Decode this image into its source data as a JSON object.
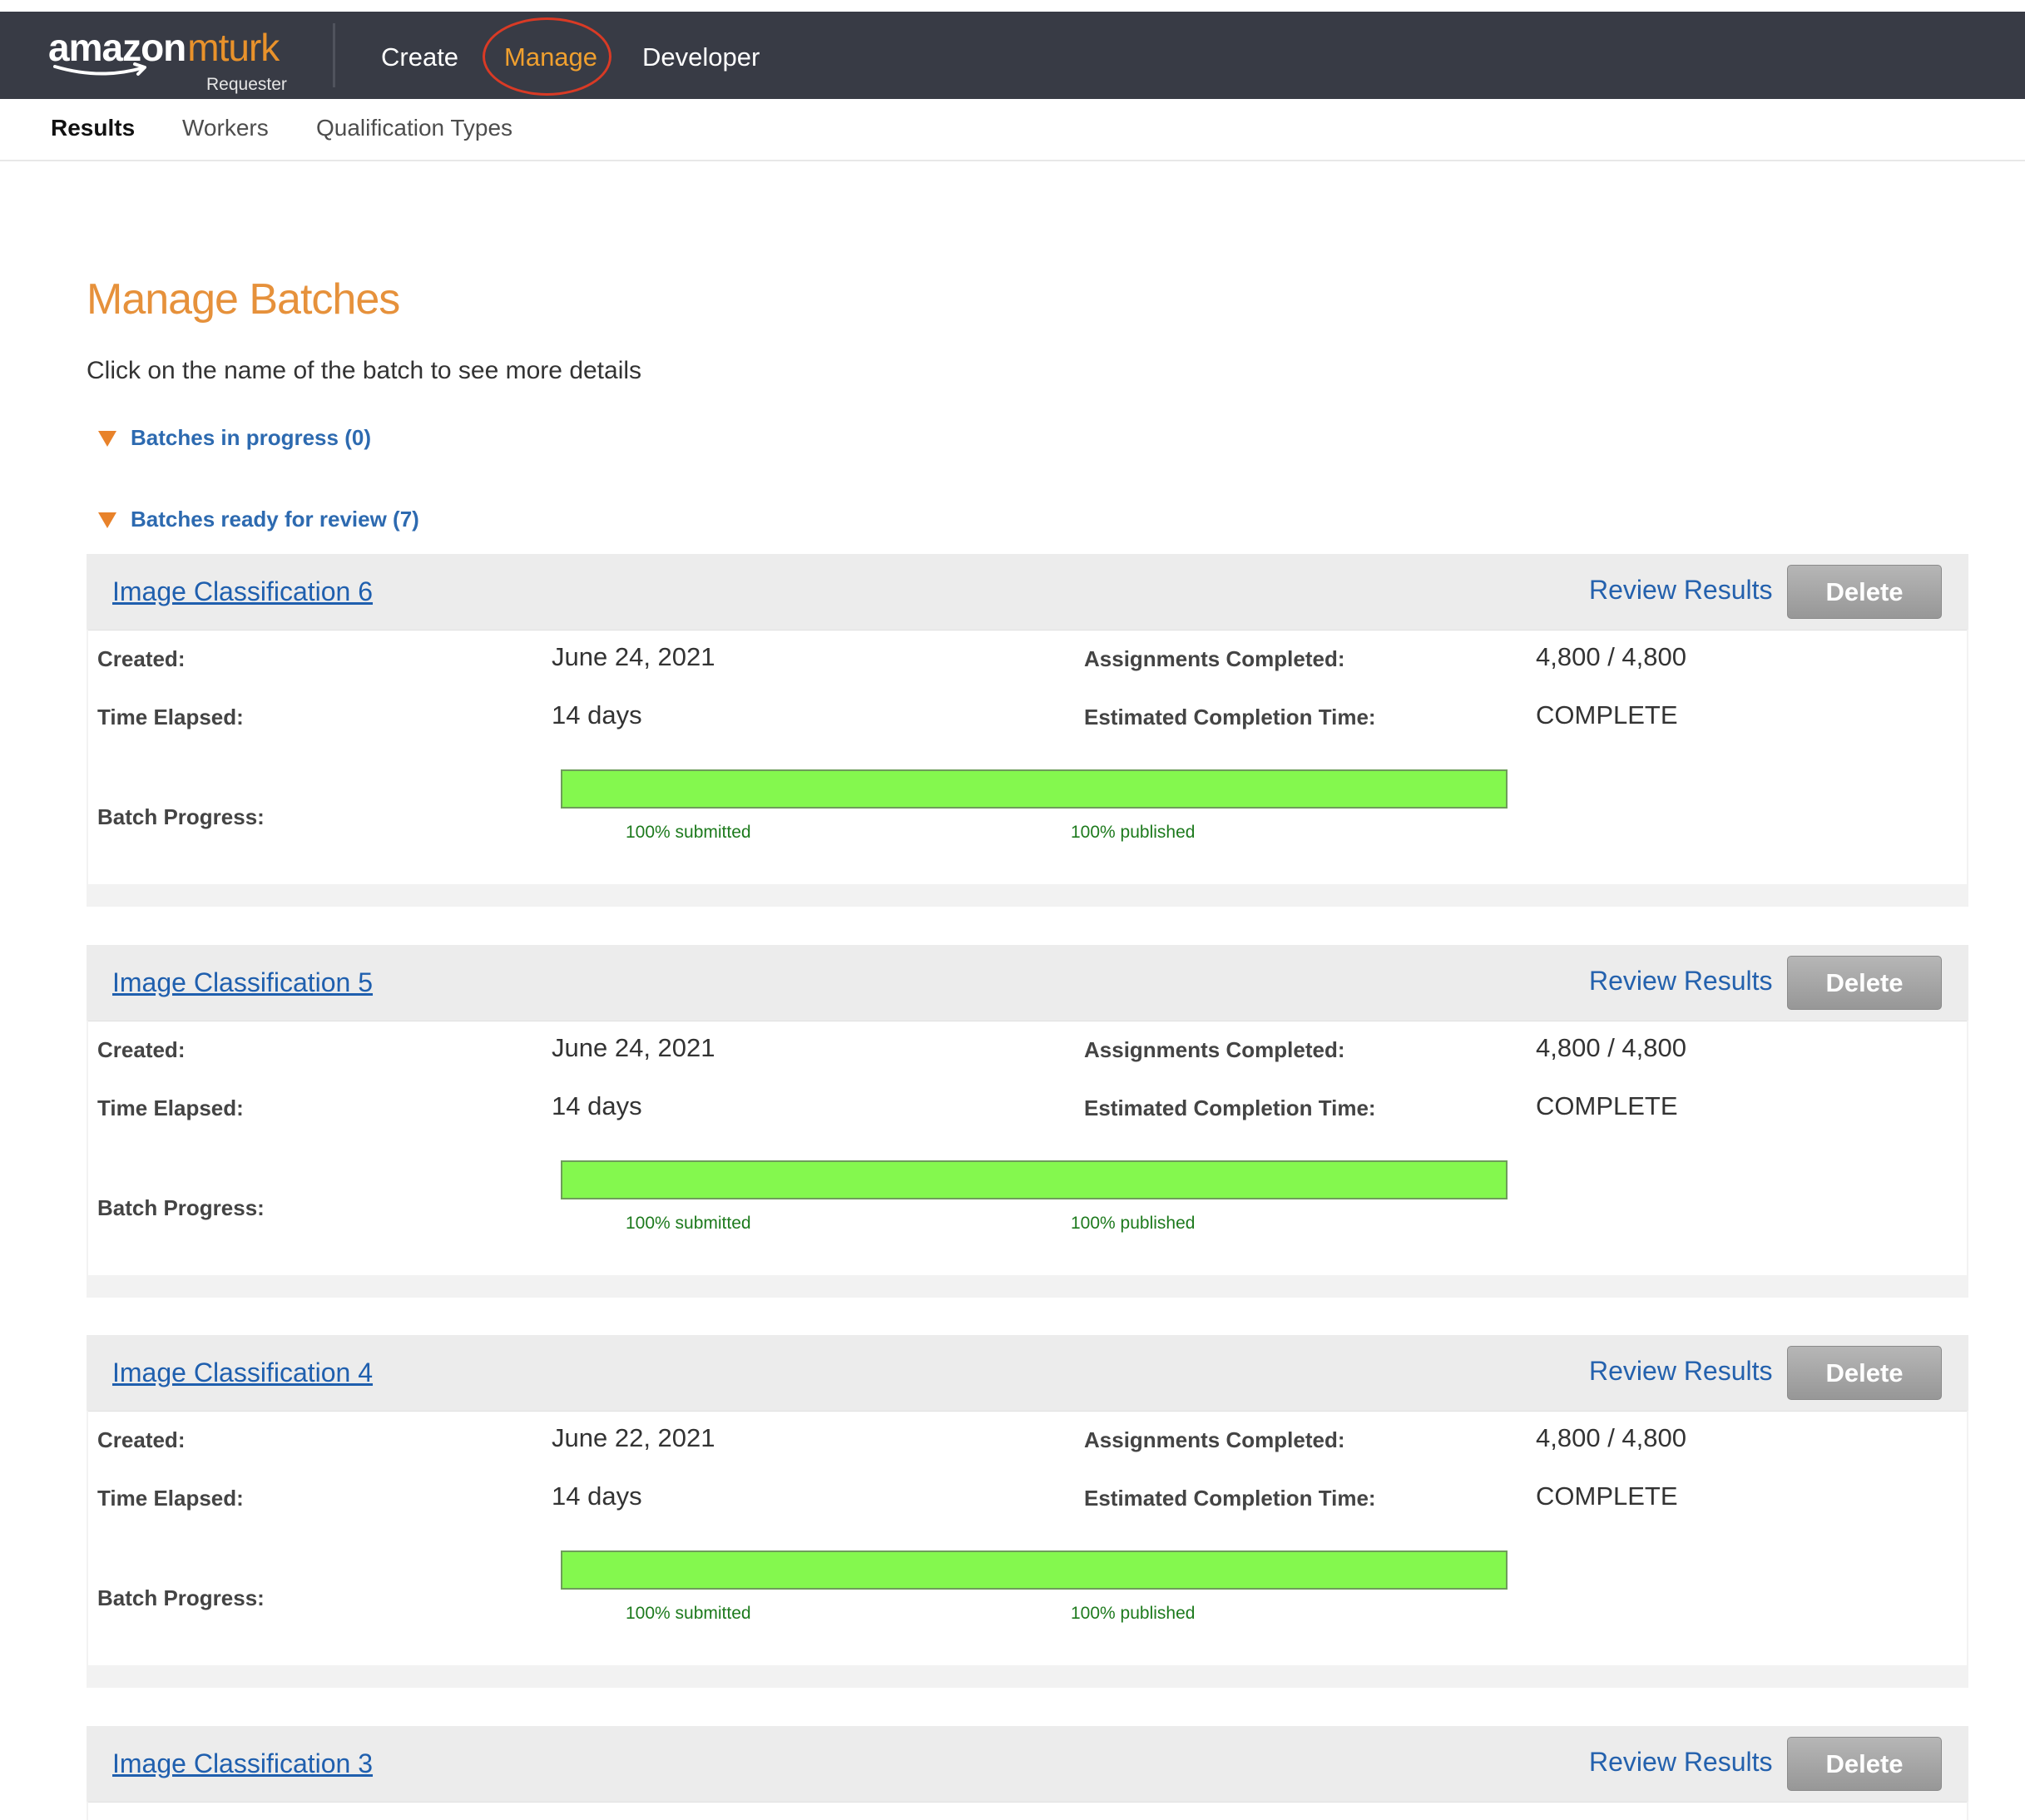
{
  "header": {
    "logo_amazon": "amazon",
    "logo_mturk": "mturk",
    "logo_sub": "Requester",
    "nav": [
      {
        "label": "Create",
        "active": false
      },
      {
        "label": "Manage",
        "active": true
      },
      {
        "label": "Developer",
        "active": false
      }
    ]
  },
  "subnav": [
    {
      "label": "Results",
      "active": true
    },
    {
      "label": "Workers",
      "active": false
    },
    {
      "label": "Qualification Types",
      "active": false
    }
  ],
  "page": {
    "title": "Manage Batches",
    "instruction": "Click on the name of the batch to see more details"
  },
  "sections": {
    "in_progress": "Batches in progress (0)",
    "ready_for_review": "Batches ready for review (7)"
  },
  "labels": {
    "created": "Created:",
    "time_elapsed": "Time Elapsed:",
    "assignments_completed": "Assignments Completed:",
    "estimated_completion": "Estimated Completion Time:",
    "batch_progress": "Batch Progress:",
    "review_results": "Review Results",
    "delete": "Delete"
  },
  "batches": [
    {
      "name": "Image Classification 6",
      "created": "June 24, 2021",
      "time_elapsed": "14 days",
      "assignments": "4,800 / 4,800",
      "estimated": "COMPLETE",
      "progress": 1.0,
      "submitted": "100% submitted",
      "published": "100% published"
    },
    {
      "name": "Image Classification 5",
      "created": "June 24, 2021",
      "time_elapsed": "14 days",
      "assignments": "4,800 / 4,800",
      "estimated": "COMPLETE",
      "progress": 1.0,
      "submitted": "100% submitted",
      "published": "100% published"
    },
    {
      "name": "Image Classification 4",
      "created": "June 22, 2021",
      "time_elapsed": "14 days",
      "assignments": "4,800 / 4,800",
      "estimated": "COMPLETE",
      "progress": 1.0,
      "submitted": "100% submitted",
      "published": "100% published"
    },
    {
      "name": "Image Classification 3"
    }
  ],
  "colors": {
    "topbar": "#383b45",
    "accent_orange": "#e6913b",
    "link_blue": "#2461ad",
    "progress_fill": "#84f84e",
    "annotation_circle": "#d93a25"
  },
  "icons": {
    "section_toggle": "triangle-down-icon",
    "logo_smile": "amazon-smile-icon"
  }
}
